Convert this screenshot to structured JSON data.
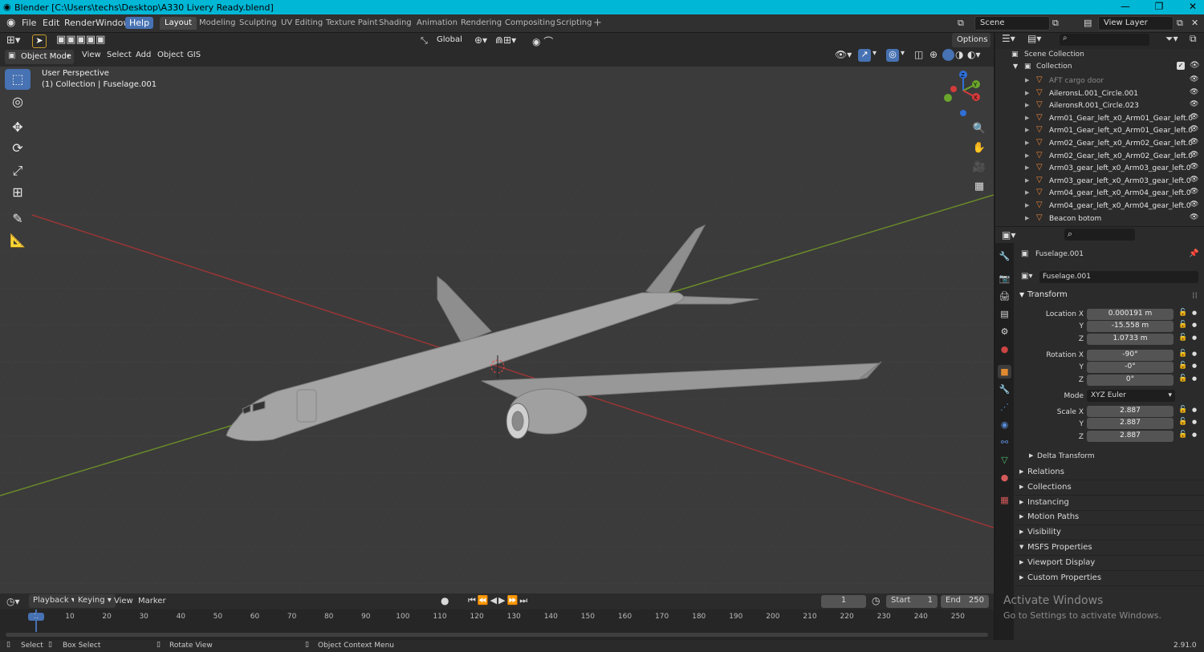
{
  "titlebar": {
    "title": "Blender [C:\\Users\\techs\\Desktop\\A330 Livery Ready.blend]"
  },
  "menubar": {
    "items": [
      "File",
      "Edit",
      "Render",
      "Window"
    ],
    "help": "Help",
    "workspaces": [
      "Layout",
      "Modeling",
      "Sculpting",
      "UV Editing",
      "Texture Paint",
      "Shading",
      "Animation",
      "Rendering",
      "Compositing",
      "Scripting"
    ],
    "scene": "Scene",
    "view_layer": "View Layer"
  },
  "viewport_header": {
    "transform_orientation": "Global",
    "options": "Options",
    "mode": "Object Mode",
    "menus": [
      "View",
      "Select",
      "Add",
      "Object",
      "GIS"
    ]
  },
  "viewport": {
    "perspective": "User Perspective",
    "context": "(1) Collection | Fuselage.001",
    "gizmo": {
      "y": "Y",
      "x": "X",
      "z": "Z"
    }
  },
  "outliner": {
    "root": "Scene Collection",
    "collection": "Collection",
    "items": [
      "AFT cargo door",
      "AileronsL.001_Circle.001",
      "AileronsR.001_Circle.023",
      "Arm01_Gear_left_x0_Arm01_Gear_left.0",
      "Arm01_Gear_left_x0_Arm01_Gear_left.0",
      "Arm02_Gear_left_x0_Arm02_Gear_left.0",
      "Arm02_Gear_left_x0_Arm02_Gear_left.0",
      "Arm03_gear_left_x0_Arm03_gear_left.0",
      "Arm03_gear_left_x0_Arm03_gear_left.0",
      "Arm04_gear_left_x0_Arm04_gear_left.0",
      "Arm04_gear_left_x0_Arm04_gear_left.0",
      "Beacon botom"
    ]
  },
  "properties": {
    "object_name": "Fuselage.001",
    "object_field": "Fuselage.001",
    "transform": "Transform",
    "location": {
      "label": "Location X",
      "x": "0.000191 m",
      "y": "-15.558 m",
      "z": "1.0733 m"
    },
    "rotation": {
      "label": "Rotation X",
      "x": "-90°",
      "y": "-0°",
      "z": "0°"
    },
    "mode_label": "Mode",
    "mode": "XYZ Euler",
    "scale": {
      "label": "Scale X",
      "x": "2.887",
      "y": "2.887",
      "z": "2.887"
    },
    "axis_y": "Y",
    "axis_z": "Z",
    "delta": "Delta Transform",
    "sections": [
      "Relations",
      "Collections",
      "Instancing",
      "Motion Paths",
      "Visibility",
      "MSFS Properties",
      "Viewport Display",
      "Custom Properties"
    ]
  },
  "timeline": {
    "menus": [
      "Playback",
      "Keying",
      "View",
      "Marker"
    ],
    "current_frame": "1",
    "start_label": "Start",
    "start": "1",
    "end_label": "End",
    "end": "250",
    "ticks": [
      "1",
      "10",
      "20",
      "30",
      "40",
      "50",
      "60",
      "70",
      "80",
      "90",
      "100",
      "110",
      "120",
      "130",
      "140",
      "150",
      "160",
      "170",
      "180",
      "190",
      "200",
      "210",
      "220",
      "230",
      "240",
      "250"
    ]
  },
  "statusbar": {
    "select": "Select",
    "box_select": "Box Select",
    "rotate_view": "Rotate View",
    "context_menu": "Object Context Menu",
    "version": "2.91.0"
  },
  "watermark": {
    "title": "Activate Windows",
    "subtitle": "Go to Settings to activate Windows."
  }
}
